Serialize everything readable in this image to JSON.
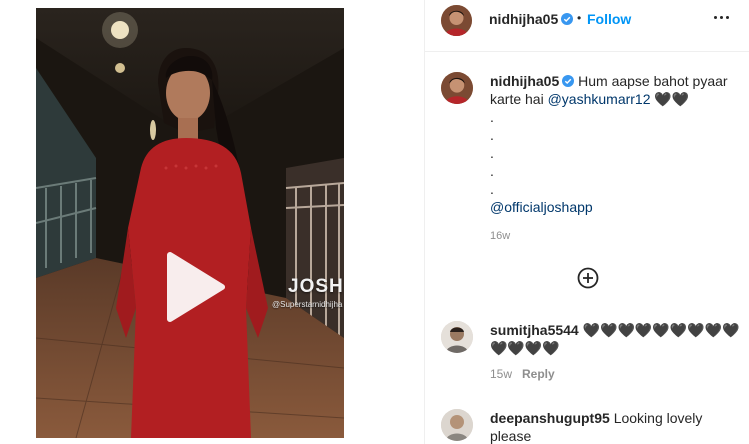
{
  "post": {
    "username": "nidhijha05",
    "separator": "•",
    "follow_label": "Follow",
    "more_options_icon": "more-horizontal-icon",
    "verified_icon": "verified-badge-icon",
    "brand_color": "#0095f6"
  },
  "media": {
    "watermark_brand": "JOSH",
    "watermark_handle": "@Superstarnidhijha",
    "play_icon": "play-icon"
  },
  "caption": {
    "username": "nidhijha05",
    "text": "Hum aapse bahot pyaar karte hai",
    "mention": "@yashkumarr12",
    "emoji": "🖤🖤",
    "dot": ".",
    "tag": "@officialjoshapp",
    "time": "16w"
  },
  "load_more_icon": "plus-circle-icon",
  "comments": [
    {
      "username": "sumitjha5544",
      "text": "🖤🖤🖤🖤🖤🖤🖤🖤🖤🖤🖤🖤🖤",
      "time": "15w",
      "reply_label": "Reply"
    },
    {
      "username": "deepanshugupt95",
      "text": "Looking lovely please"
    }
  ]
}
